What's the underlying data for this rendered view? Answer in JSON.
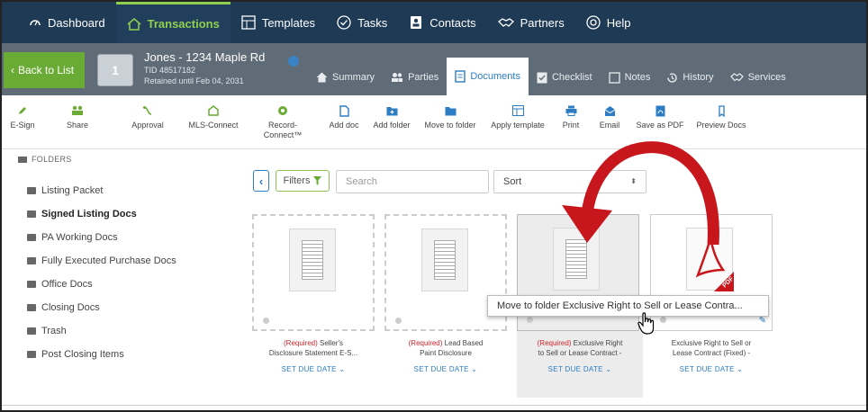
{
  "topnav": {
    "items": [
      {
        "label": "Dashboard",
        "icon": "dashboard-icon"
      },
      {
        "label": "Transactions",
        "icon": "home-icon",
        "active": true
      },
      {
        "label": "Templates",
        "icon": "templates-icon"
      },
      {
        "label": "Tasks",
        "icon": "check-circle-icon"
      },
      {
        "label": "Contacts",
        "icon": "contacts-icon"
      },
      {
        "label": "Partners",
        "icon": "handshake-icon"
      },
      {
        "label": "Help",
        "icon": "help-icon"
      }
    ]
  },
  "record": {
    "back_label": "Back to List",
    "thumb_text": "1",
    "title": "Jones - 1234 Maple Rd",
    "tid": "TID 48517182",
    "retained": "Retained until Feb 04, 2031"
  },
  "record_tabs": [
    {
      "label": "Summary",
      "icon": "home-icon"
    },
    {
      "label": "Parties",
      "icon": "people-icon"
    },
    {
      "label": "Documents",
      "icon": "document-icon",
      "active": true
    },
    {
      "label": "Checklist",
      "icon": "checklist-icon"
    },
    {
      "label": "Notes",
      "icon": "notes-icon"
    },
    {
      "label": "History",
      "icon": "history-icon"
    },
    {
      "label": "Services",
      "icon": "services-icon"
    }
  ],
  "toolbar": [
    {
      "label": "E-Sign",
      "icon": "pen-icon"
    },
    {
      "label": "Share",
      "icon": "share-icon"
    },
    {
      "label": "Approval",
      "icon": "approval-icon"
    },
    {
      "label": "MLS-Connect",
      "icon": "mls-icon"
    },
    {
      "label": "Record-\nConnect™",
      "icon": "record-connect-icon"
    },
    {
      "label": "Add doc",
      "icon": "add-doc-icon"
    },
    {
      "label": "Add folder",
      "icon": "add-folder-icon"
    },
    {
      "label": "Move to folder",
      "icon": "move-folder-icon"
    },
    {
      "label": "Apply template",
      "icon": "template-icon"
    },
    {
      "label": "Print",
      "icon": "print-icon"
    },
    {
      "label": "Email",
      "icon": "email-icon"
    },
    {
      "label": "Save as PDF",
      "icon": "pdf-icon"
    },
    {
      "label": "Preview Docs",
      "icon": "preview-icon"
    }
  ],
  "folders": {
    "heading": "FOLDERS",
    "items": [
      {
        "label": "Listing Packet"
      },
      {
        "label": "Signed Listing Docs",
        "bold": true
      },
      {
        "label": "PA Working Docs"
      },
      {
        "label": "Fully Executed Purchase Docs"
      },
      {
        "label": "Office Docs"
      },
      {
        "label": "Closing Docs"
      },
      {
        "label": "Trash"
      },
      {
        "label": "Post Closing Items"
      }
    ]
  },
  "filterbar": {
    "filters_label": "Filters",
    "search_placeholder": "Search",
    "sort_label": "Sort"
  },
  "documents": [
    {
      "required": "(Required)",
      "name_l1": " Seller's",
      "name_l2": "Disclosure Statement E-S...",
      "due": "SET DUE DATE"
    },
    {
      "required": "(Required)",
      "name_l1": " Lead Based",
      "name_l2": "Paint Disclosure",
      "due": "SET DUE DATE"
    },
    {
      "required": "(Required)",
      "name_l1": " Exclusive Right",
      "name_l2": "to Sell or Lease Contract -",
      "due": "SET DUE DATE"
    },
    {
      "required": "",
      "name_l1": "Exclusive Right to Sell or",
      "name_l2": "Lease Contract (Fixed) -",
      "due": "SET DUE DATE"
    }
  ],
  "tooltip": "Move to folder Exclusive Right to Sell or Lease Contra...",
  "colors": {
    "nav_bg": "#1f3a55",
    "accent_green": "#8fd14f",
    "link_blue": "#2c7dc4",
    "required_red": "#d0242a",
    "arrow_red": "#c8161d"
  }
}
